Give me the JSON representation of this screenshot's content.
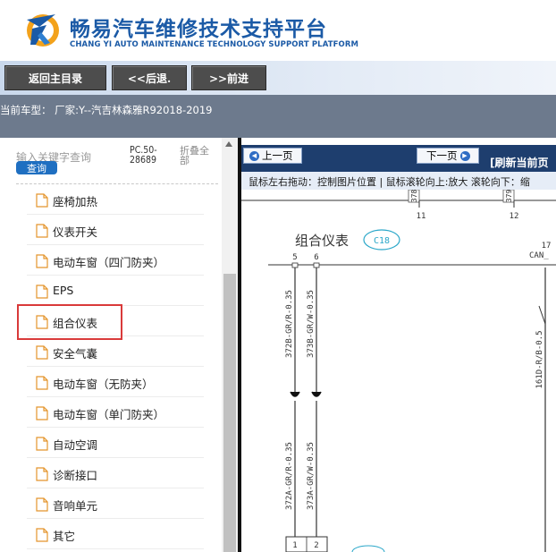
{
  "header": {
    "title": "畅易汽车维修技术支持平台",
    "subtitle": "CHANG YI AUTO MAINTENANCE TECHNOLOGY SUPPORT PLATFORM"
  },
  "toolbar": {
    "home_label": "返回主目录",
    "back_label": "<<后退.",
    "forward_label": ">>前进"
  },
  "vehicle": {
    "text": "当前车型：  厂家:Y--汽吉林森雅R92018-2019"
  },
  "sidebar": {
    "search_placeholder": "输入关键字查询",
    "query_label": "查询",
    "code": "PC.50-28689",
    "collapse_label": "折叠全部",
    "items": [
      {
        "label": "座椅加热"
      },
      {
        "label": "仪表开关"
      },
      {
        "label": "电动车窗（四门防夹）"
      },
      {
        "label": "EPS"
      },
      {
        "label": "组合仪表"
      },
      {
        "label": "安全气囊"
      },
      {
        "label": "电动车窗（无防夹）"
      },
      {
        "label": "电动车窗（单门防夹）"
      },
      {
        "label": "自动空调"
      },
      {
        "label": "诊断接口"
      },
      {
        "label": "音响单元"
      },
      {
        "label": "其它"
      }
    ]
  },
  "viewer": {
    "prev_label": "上一页",
    "next_label": "下一页",
    "refresh_label": "[刷新当前页",
    "hint": "鼠标左右拖动：控制图片位置 | 鼠标滚轮向上:放大  滚轮向下：缩"
  },
  "diagram": {
    "title": "组合仪表",
    "connector": "C18",
    "pins_top": [
      "5",
      "6",
      "17"
    ],
    "pins_upper": [
      "11",
      "12"
    ],
    "refs_upper": [
      "378",
      "379"
    ],
    "wires": [
      "372B-GR/R-0.35",
      "373B-GR/W-0.35",
      "161D-R/B-0.5",
      "372A-GR/R-0.35",
      "373A-GR/W-0.35"
    ],
    "net_label": "CAN_",
    "bottom_pins": [
      "1",
      "2"
    ]
  },
  "colors": {
    "brand_blue": "#1b5aa6",
    "toolbar_button": "#4d4d4d",
    "info_band": "#6d7a8d",
    "viewer_bar": "#1e3e6e",
    "highlight_red": "#d93a3a",
    "diagram_cyan": "#2aa7c9"
  }
}
